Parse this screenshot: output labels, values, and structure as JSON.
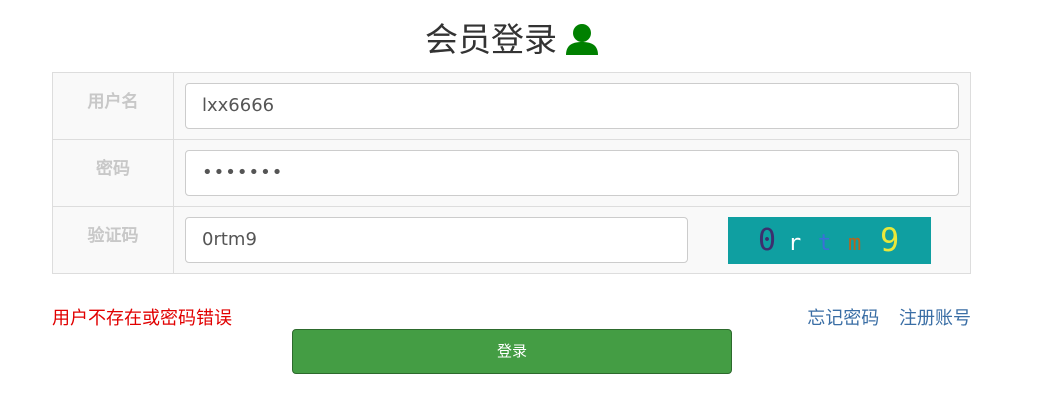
{
  "header": {
    "title": "会员登录",
    "icon": "user-icon"
  },
  "form": {
    "username": {
      "label": "用户名",
      "value": "lxx6666"
    },
    "password": {
      "label": "密码",
      "value": "•••••••"
    },
    "captcha": {
      "label": "验证码",
      "value": "0rtm9",
      "image_chars": [
        "0",
        "r",
        "t",
        "m",
        "9"
      ],
      "image_colors": [
        "#3c2f6e",
        "#ffffff",
        "#3b6fd8",
        "#b5651d",
        "#e8e83a"
      ],
      "image_bg": "#0f9fa1"
    }
  },
  "error_message": "用户不存在或密码错误",
  "links": {
    "forgot": "忘记密码",
    "register": "注册账号"
  },
  "login_button": "登录",
  "colors": {
    "error": "#e10000",
    "link": "#3a6ea5",
    "button": "#449d44"
  }
}
